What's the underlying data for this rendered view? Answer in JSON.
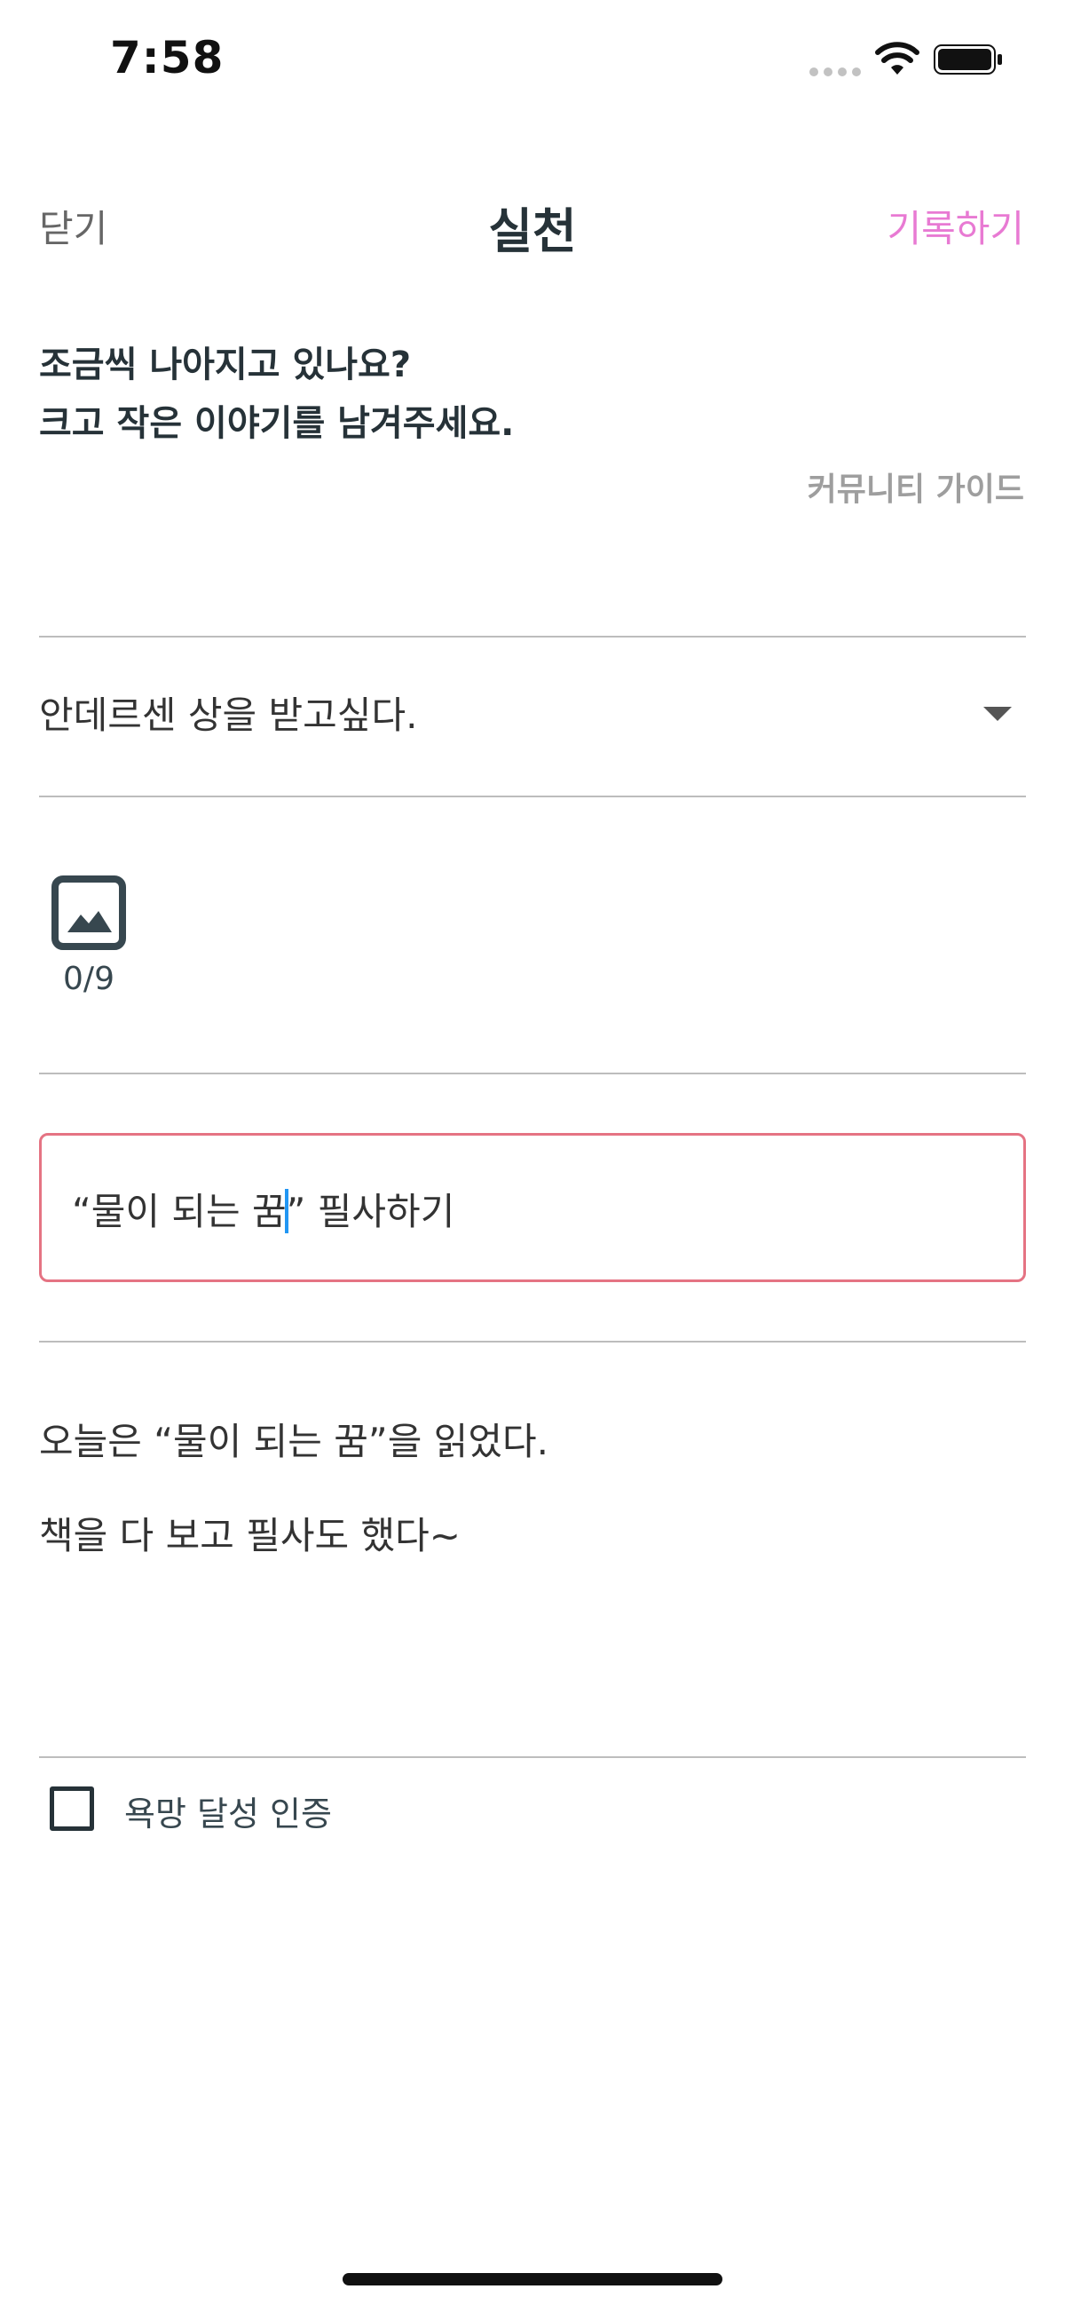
{
  "status_bar": {
    "time": "7:58"
  },
  "nav": {
    "close_label": "닫기",
    "title": "실천",
    "submit_label": "기록하기"
  },
  "intro": {
    "line1": "조금씩 나아지고 있나요?",
    "line2": "크고 작은 이야기를 남겨주세요."
  },
  "guide_link": "커뮤니티 가이드",
  "goal_select": {
    "value": "안데르센 상을 받고싶다."
  },
  "photos": {
    "count": "0/9"
  },
  "title_input": {
    "value_before_caret": "“물이 되는 꿈",
    "value_after_caret": "” 필사하기"
  },
  "content": {
    "paragraphs": [
      "오늘은 “물이 되는 꿈”을 읽었다.",
      "책을 다 보고 필사도 했다~"
    ]
  },
  "achievement_check": {
    "label": "욕망 달성 인증",
    "checked": false
  },
  "colors": {
    "accent": "#e87ad3",
    "input_border": "#e57383",
    "caret": "#2196f3",
    "text_dark": "#263238"
  }
}
